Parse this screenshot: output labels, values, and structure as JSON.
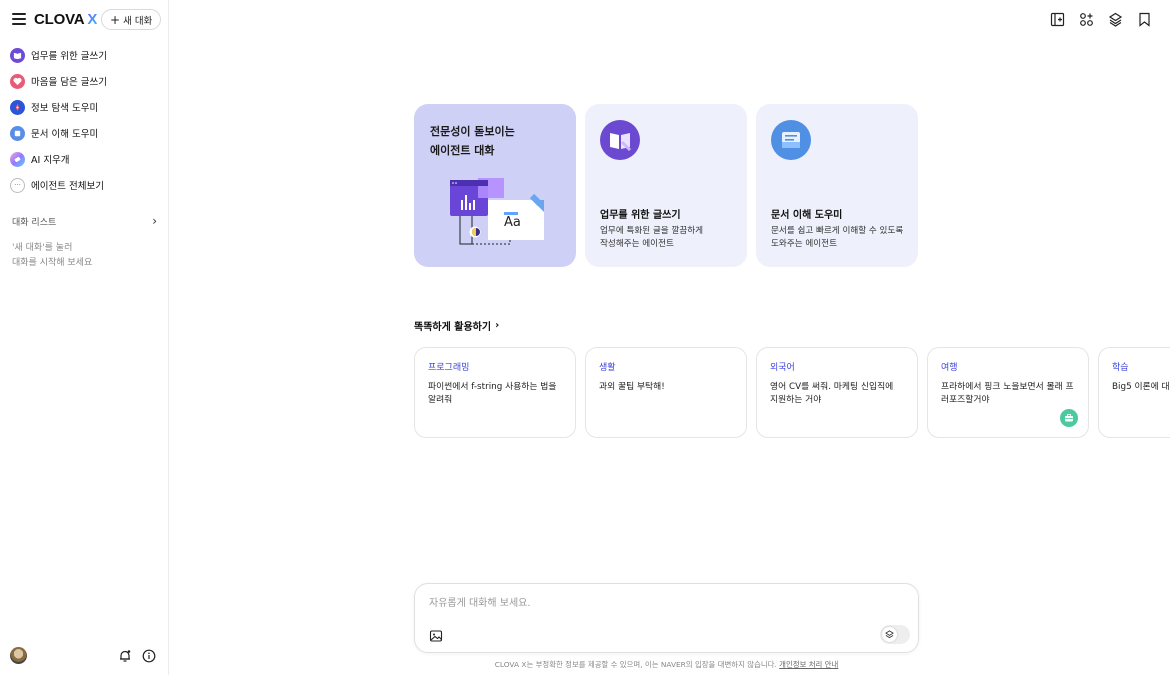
{
  "sidebar": {
    "logo": "CLOVA",
    "logo_x": "X",
    "new_chat_label": "새 대화",
    "items": [
      {
        "label": "업무를 위한 글쓰기",
        "icon": "book-icon"
      },
      {
        "label": "마음을 담은 글쓰기",
        "icon": "heart-icon"
      },
      {
        "label": "정보 탐색 도우미",
        "icon": "compass-icon"
      },
      {
        "label": "문서 이해 도우미",
        "icon": "document-icon"
      },
      {
        "label": "AI 지우개",
        "icon": "eraser-icon"
      },
      {
        "label": "에이전트 전체보기",
        "icon": "more-icon"
      }
    ],
    "chat_list_title": "대화 리스트",
    "empty_hint": "'새 대화'를 눌러\n대화를 시작해 보세요"
  },
  "agents": {
    "featured_title": "전문성이 돋보이는\n에이전트 대화",
    "cards": [
      {
        "name": "업무를 위한 글쓰기",
        "desc": "업무에 특화된 글을 깔끔하게\n작성해주는 에이전트"
      },
      {
        "name": "문서 이해 도우미",
        "desc": "문서를 쉽고 빠르게 이해할 수 있도록\n도와주는 에이전트"
      }
    ]
  },
  "tips": {
    "section_title": "똑똑하게 활용하기",
    "items": [
      {
        "category": "프로그래밍",
        "text": "파이썬에서 f-string 사용하는 법을 알려줘"
      },
      {
        "category": "생활",
        "text": "과외 꿀팁 부탁해!"
      },
      {
        "category": "외국어",
        "text": "영어 CV를 써줘. 마케팅 신입직에 지원하는 거야"
      },
      {
        "category": "여행",
        "text": "프라하에서 핑크 노을보면서 몰래 프러포즈할거야"
      },
      {
        "category": "학습",
        "text": "Big5 이론에 대"
      }
    ]
  },
  "composer": {
    "placeholder": "자유롭게 대화해 보세요."
  },
  "footer": {
    "disclaimer": "CLOVA X는 부정확한 정보를 제공할 수 있으며, 이는 NAVER의 입장을 대변하지 않습니다.",
    "privacy_link": "개인정보 처리 안내"
  },
  "colors": {
    "accent": "#3b41d9",
    "featured_card": "#cfd0f5",
    "card_bg": "#eef0fb"
  }
}
